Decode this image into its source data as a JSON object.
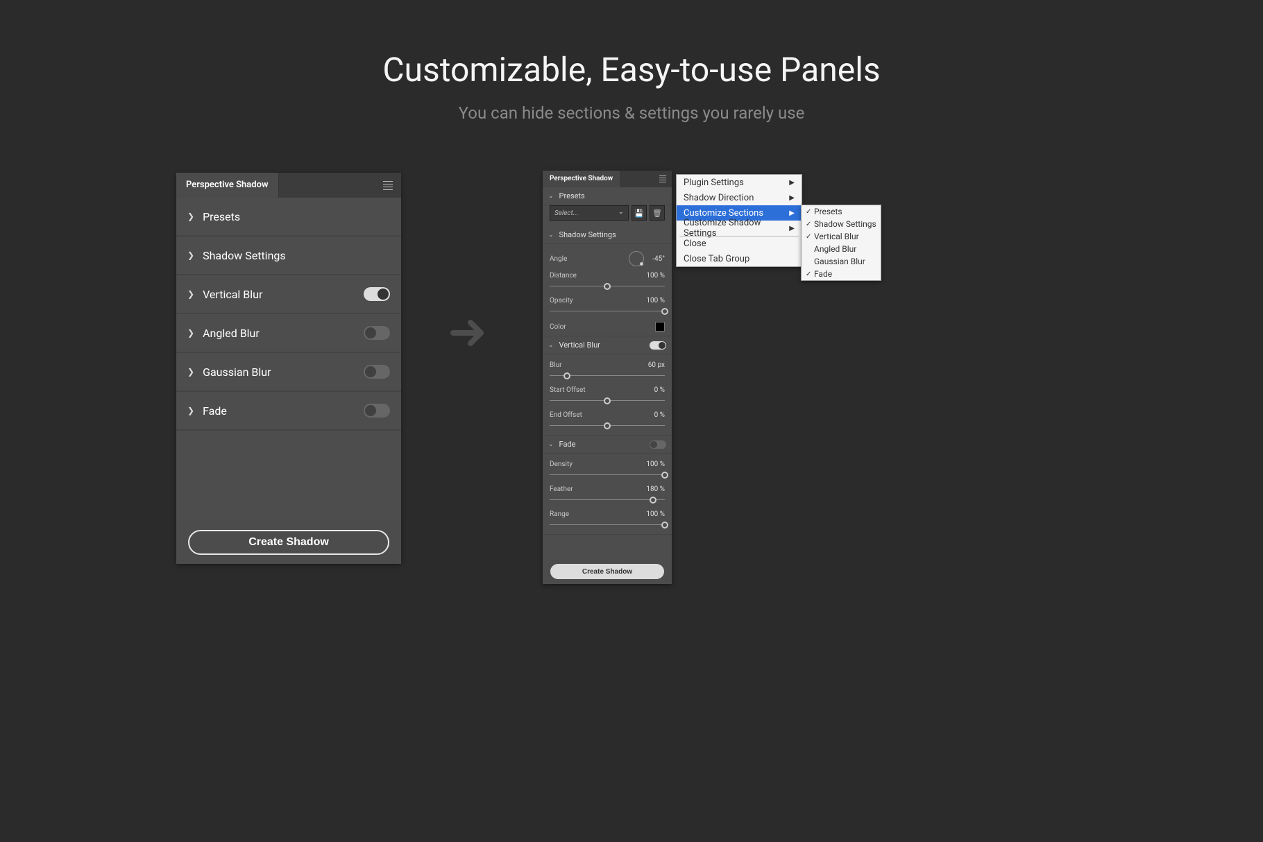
{
  "heading": {
    "title": "Customizable, Easy-to-use Panels",
    "subtitle": "You can hide sections & settings you rarely use"
  },
  "leftPanel": {
    "tabTitle": "Perspective Shadow",
    "sections": {
      "presets": "Presets",
      "shadowSettings": "Shadow Settings",
      "verticalBlur": "Vertical Blur",
      "angledBlur": "Angled Blur",
      "gaussianBlur": "Gaussian Blur",
      "fade": "Fade"
    },
    "createLabel": "Create Shadow"
  },
  "rightPanel": {
    "tabTitle": "Perspective Shadow",
    "presets": {
      "header": "Presets",
      "selectPlaceholder": "Select..."
    },
    "shadowSettings": {
      "header": "Shadow Settings",
      "angleLabel": "Angle",
      "angleValue": "-45°",
      "distanceLabel": "Distance",
      "distanceValue": "100 %",
      "opacityLabel": "Opacity",
      "opacityValue": "100 %",
      "colorLabel": "Color"
    },
    "verticalBlur": {
      "header": "Vertical Blur",
      "blurLabel": "Blur",
      "blurValue": "60 px",
      "startOffsetLabel": "Start Offset",
      "startOffsetValue": "0 %",
      "endOffsetLabel": "End Offset",
      "endOffsetValue": "0 %"
    },
    "fade": {
      "header": "Fade",
      "densityLabel": "Density",
      "densityValue": "100 %",
      "featherLabel": "Feather",
      "featherValue": "180 %",
      "rangeLabel": "Range",
      "rangeValue": "100 %"
    },
    "createLabel": "Create Shadow"
  },
  "flyout": {
    "pluginSettings": "Plugin Settings",
    "shadowDirection": "Shadow Direction",
    "customizeSections": "Customize Sections",
    "customizeShadowSettings": "Customize Shadow Settings",
    "close": "Close",
    "closeTabGroup": "Close Tab Group"
  },
  "subflyout": {
    "presets": "Presets",
    "shadowSettings": "Shadow Settings",
    "verticalBlur": "Vertical Blur",
    "angledBlur": "Angled Blur",
    "gaussianBlur": "Gaussian Blur",
    "fade": "Fade"
  }
}
